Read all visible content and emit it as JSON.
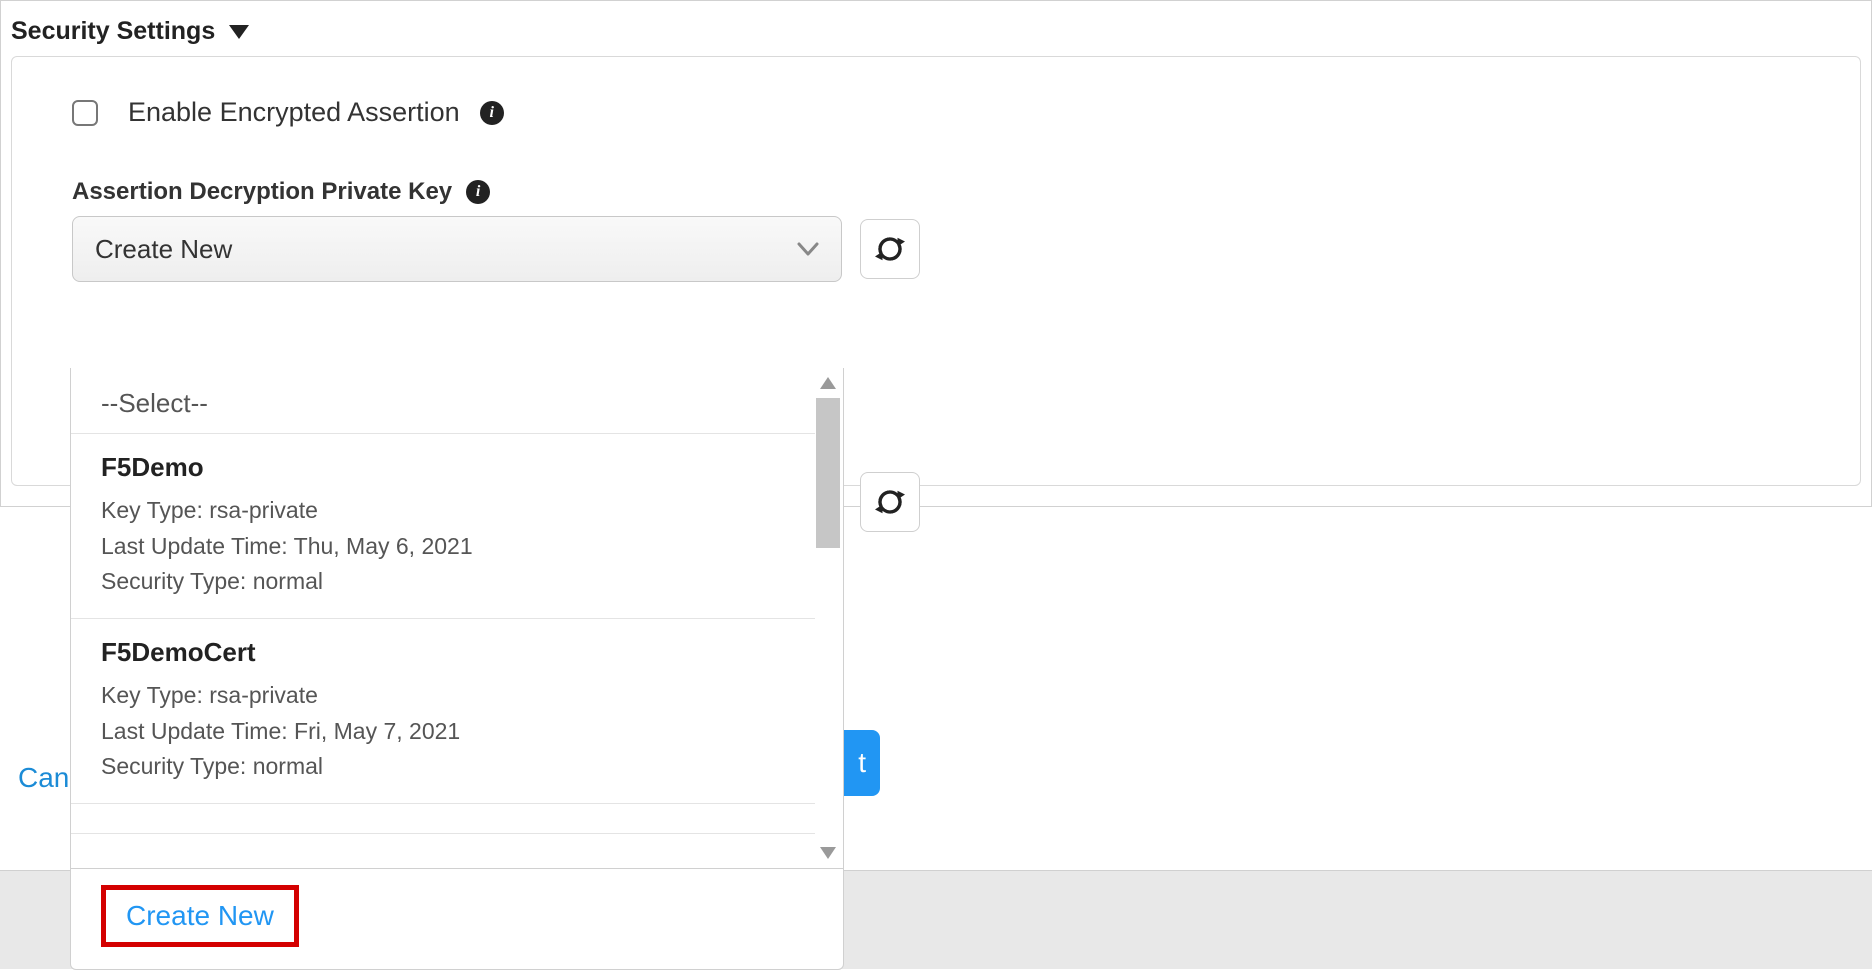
{
  "section_title": "Security Settings",
  "enable_encrypted_assertion": {
    "label": "Enable Encrypted Assertion",
    "checked": false
  },
  "assertion_key_field": {
    "label": "Assertion Decryption Private Key",
    "selected": "Create New"
  },
  "dropdown": {
    "placeholder_option": "--Select--",
    "items": [
      {
        "title": "F5Demo",
        "key_type_label": "Key Type:",
        "key_type_value": "rsa-private",
        "last_update_label": "Last Update Time:",
        "last_update_value": "Thu, May 6, 2021",
        "security_type_label": "Security Type:",
        "security_type_value": "normal"
      },
      {
        "title": "F5DemoCert",
        "key_type_label": "Key Type:",
        "key_type_value": "rsa-private",
        "last_update_label": "Last Update Time:",
        "last_update_value": "Fri, May 7, 2021",
        "security_type_label": "Security Type:",
        "security_type_value": "normal"
      }
    ],
    "create_new_label": "Create New"
  },
  "footer": {
    "cancel": "Can",
    "next": "t"
  }
}
